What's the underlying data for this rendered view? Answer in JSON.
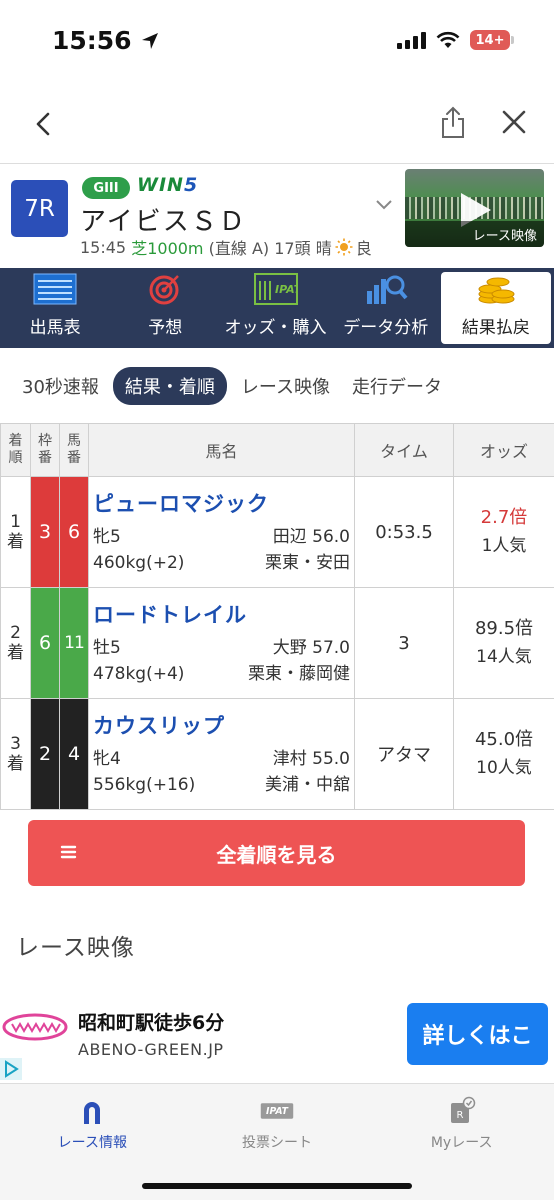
{
  "status_bar": {
    "time": "15:56",
    "battery": "14+"
  },
  "race": {
    "number": "7R",
    "grade": "GIII",
    "win5_prefix": "WIN",
    "win5_suffix": "5",
    "name": "アイビスＳＤ",
    "time": "15:45",
    "surface": "芝1000m",
    "course": "(直線 A)",
    "runners": "17頭",
    "weather": "晴",
    "condition": "良",
    "video_label": "レース映像"
  },
  "main_tabs": [
    {
      "label": "出馬表",
      "icon": "racecard-icon"
    },
    {
      "label": "予想",
      "icon": "target-icon"
    },
    {
      "label": "オッズ・購入",
      "icon": "ipat-icon",
      "icon_text": "IPAT"
    },
    {
      "label": "データ分析",
      "icon": "chart-search-icon"
    },
    {
      "label": "結果払戻",
      "icon": "coins-icon",
      "active": true
    }
  ],
  "sub_tabs": [
    "30秒速報",
    "結果・着順",
    "レース映像",
    "走行データ"
  ],
  "sub_tab_active": 1,
  "table": {
    "headers": {
      "pos": "着順",
      "waku": "枠番",
      "uma": "馬番",
      "name": "馬名",
      "time": "タイム",
      "odds": "オッズ"
    },
    "rows": [
      {
        "pos_num": "1",
        "pos_unit": "着",
        "waku": "3",
        "uma": "6",
        "color": "#dd3b3b",
        "name": "ピューロマジック",
        "sex_age": "牝5",
        "jockey_weight": "田辺 56.0",
        "body_weight": "460kg(+2)",
        "stable": "栗東・安田",
        "time": "0:53.5",
        "odds": "2.7倍",
        "popularity": "1人気"
      },
      {
        "pos_num": "2",
        "pos_unit": "着",
        "waku": "6",
        "uma": "11",
        "color": "#4aa949",
        "name": "ロードトレイル",
        "sex_age": "牡5",
        "jockey_weight": "大野 57.0",
        "body_weight": "478kg(+4)",
        "stable": "栗東・藤岡健",
        "time": "3",
        "odds": "89.5倍",
        "popularity": "14人気"
      },
      {
        "pos_num": "3",
        "pos_unit": "着",
        "waku": "2",
        "uma": "4",
        "color": "#222222",
        "name": "カウスリップ",
        "sex_age": "牝4",
        "jockey_weight": "津村 55.0",
        "body_weight": "556kg(+16)",
        "stable": "美浦・中舘",
        "time": "アタマ",
        "odds": "45.0倍",
        "popularity": "10人気"
      }
    ]
  },
  "full_results_button": "全着順を見る",
  "video_section_title": "レース映像",
  "ad": {
    "title": "昭和町駅徒歩6分",
    "url": "ABENO-GREEN.JP",
    "button": "詳しくはこ"
  },
  "bottom_nav": [
    {
      "label": "レース情報",
      "active": true
    },
    {
      "label": "投票シート",
      "icon_text": "IPAT"
    },
    {
      "label": "Myレース",
      "icon_text": "R"
    }
  ]
}
